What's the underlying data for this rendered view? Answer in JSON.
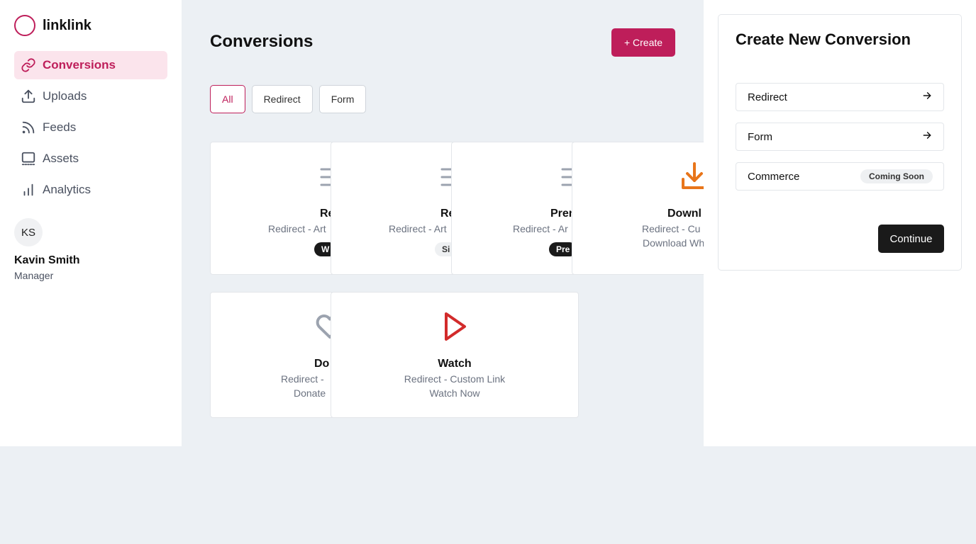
{
  "app": {
    "name": "linklink"
  },
  "sidebar": {
    "items": [
      {
        "label": "Conversions",
        "icon": "link-icon",
        "active": true
      },
      {
        "label": "Uploads",
        "icon": "upload-icon"
      },
      {
        "label": "Feeds",
        "icon": "rss-icon"
      },
      {
        "label": "Assets",
        "icon": "monitor-icon"
      },
      {
        "label": "Analytics",
        "icon": "bar-chart-icon"
      }
    ],
    "user": {
      "initials": "KS",
      "name": "Kavin Smith",
      "role": "Manager"
    }
  },
  "main": {
    "title": "Conversions",
    "create_label": "+ Create",
    "filters": [
      "All",
      "Redirect",
      "Form"
    ],
    "cards": [
      {
        "title": "Re",
        "subtitle": "Redirect - Art",
        "badge": "W",
        "icon": "list-icon",
        "color": "#9ca3af"
      },
      {
        "title": "Re",
        "subtitle": "Redirect - Art",
        "badge": "Si",
        "icon": "list-icon",
        "color": "#9ca3af"
      },
      {
        "title": "Pren",
        "subtitle": "Redirect - Ar",
        "badge": "Pre",
        "icon": "list-icon",
        "color": "#9ca3af"
      },
      {
        "title": "Downl",
        "subtitle": "Redirect - Cu",
        "line2": "Download Wh",
        "icon": "download-icon",
        "color": "#e8751a"
      },
      {
        "title": "Do",
        "subtitle": "Redirect - ",
        "line2": "Donate ",
        "icon": "heart-icon",
        "color": "#9ca3af"
      },
      {
        "title": "Watch",
        "subtitle": "Redirect - Custom Link",
        "line2": "Watch Now",
        "icon": "play-icon",
        "color": "#d22b2b"
      }
    ]
  },
  "panel": {
    "title": "Create New Conversion",
    "options": [
      {
        "label": "Redirect",
        "icon": "arrow-right-icon"
      },
      {
        "label": "Form",
        "icon": "arrow-right-icon"
      },
      {
        "label": "Commerce",
        "badge": "Coming Soon"
      }
    ],
    "continue_label": "Continue"
  },
  "colors": {
    "accent": "#be1e5a",
    "dark": "#1a1a1a",
    "background": "#ecf0f4"
  }
}
